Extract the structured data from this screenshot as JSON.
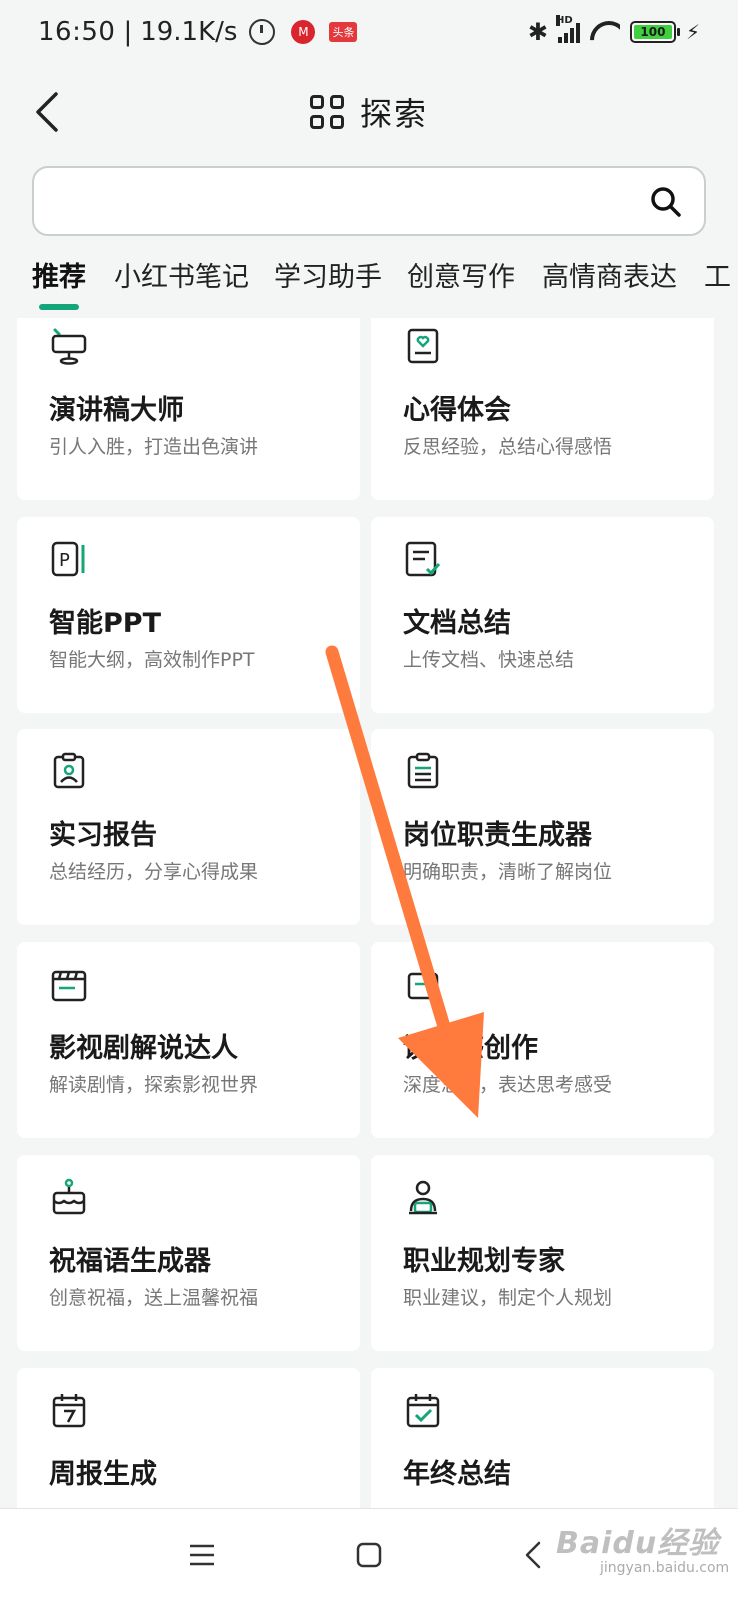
{
  "status_bar": {
    "time": "16:50",
    "speed": "19.1K/s",
    "app_badge_1": "M",
    "app_badge_2": "头条",
    "hd_label": "HD",
    "battery": "100"
  },
  "header": {
    "title": "探索"
  },
  "search": {
    "value": "",
    "placeholder": ""
  },
  "tabs": [
    {
      "label": "推荐"
    },
    {
      "label": "小红书笔记"
    },
    {
      "label": "学习助手"
    },
    {
      "label": "创意写作"
    },
    {
      "label": "高情商表达"
    },
    {
      "label": "工"
    }
  ],
  "cards": [
    {
      "title": "演讲稿大师",
      "desc": "引人入胜，打造出色演讲",
      "icon": "podium-icon"
    },
    {
      "title": "心得体会",
      "desc": "反思经验，总结心得感悟",
      "icon": "heart-note-icon"
    },
    {
      "title": "智能PPT",
      "desc": "智能大纲，高效制作PPT",
      "icon": "ppt-icon"
    },
    {
      "title": "文档总结",
      "desc": "上传文档、快速总结",
      "icon": "doc-check-icon"
    },
    {
      "title": "实习报告",
      "desc": "总结经历，分享心得成果",
      "icon": "clipboard-person-icon"
    },
    {
      "title": "岗位职责生成器",
      "desc": "明确职责，清晰了解岗位",
      "icon": "clipboard-list-icon"
    },
    {
      "title": "影视剧解说达人",
      "desc": "解读剧情，探索影视世界",
      "icon": "clapper-icon"
    },
    {
      "title": "读后感创作",
      "desc": "深度思考，表达思考感受",
      "icon": "book-icon"
    },
    {
      "title": "祝福语生成器",
      "desc": "创意祝福，送上温馨祝福",
      "icon": "cake-icon"
    },
    {
      "title": "职业规划专家",
      "desc": "职业建议，制定个人规划",
      "icon": "person-laptop-icon"
    },
    {
      "title": "周报生成",
      "desc": "",
      "icon": "calendar-7-icon"
    },
    {
      "title": "年终总结",
      "desc": "",
      "icon": "calendar-check-icon"
    }
  ],
  "watermark": {
    "brand": "Baidu经验",
    "url": "jingyan.baidu.com"
  },
  "colors": {
    "accent": "#15a57a",
    "arrow": "#ff7a3d",
    "background": "#f4f6f5"
  }
}
